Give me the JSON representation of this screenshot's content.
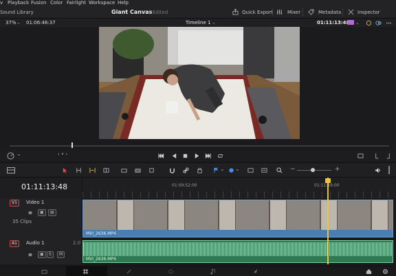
{
  "menu": [
    "Playback",
    "Fusion",
    "Color",
    "Fairlight",
    "Workspace",
    "Help"
  ],
  "menu_fragment": "v",
  "workspace": {
    "left_label": "Sound Library",
    "project_title": "Giant Canvas",
    "status": "Edited"
  },
  "header_buttons": {
    "quick_export": "Quick Export",
    "mixer": "Mixer",
    "metadata": "Metadata",
    "inspector": "Inspector"
  },
  "viewer": {
    "zoom": "37%",
    "source_timecode": "01:06:46:37",
    "timeline_name": "Timeline 1",
    "record_timecode": "01:11:13:48"
  },
  "timeline": {
    "current_timecode": "01:11:13:48",
    "ruler_marks": [
      "01:09:52:00",
      "01:11:16:00"
    ],
    "playhead_fraction": 0.78
  },
  "tracks": {
    "video": {
      "id": "V1",
      "name": "Video 1",
      "clip_count": "35 Clips",
      "clip_name": "MVI_2636.MP4"
    },
    "audio": {
      "id": "A1",
      "name": "Audio 1",
      "channels": "2.0",
      "solo": "S",
      "mute": "M",
      "clip_name": "MVI_2636.MP4"
    }
  },
  "colors": {
    "accent_red": "#d13b3b",
    "playhead": "#e8c440",
    "video_clip": "#2b4c6e",
    "audio_clip": "#2e7a52",
    "track_select": "#c84a4a"
  }
}
